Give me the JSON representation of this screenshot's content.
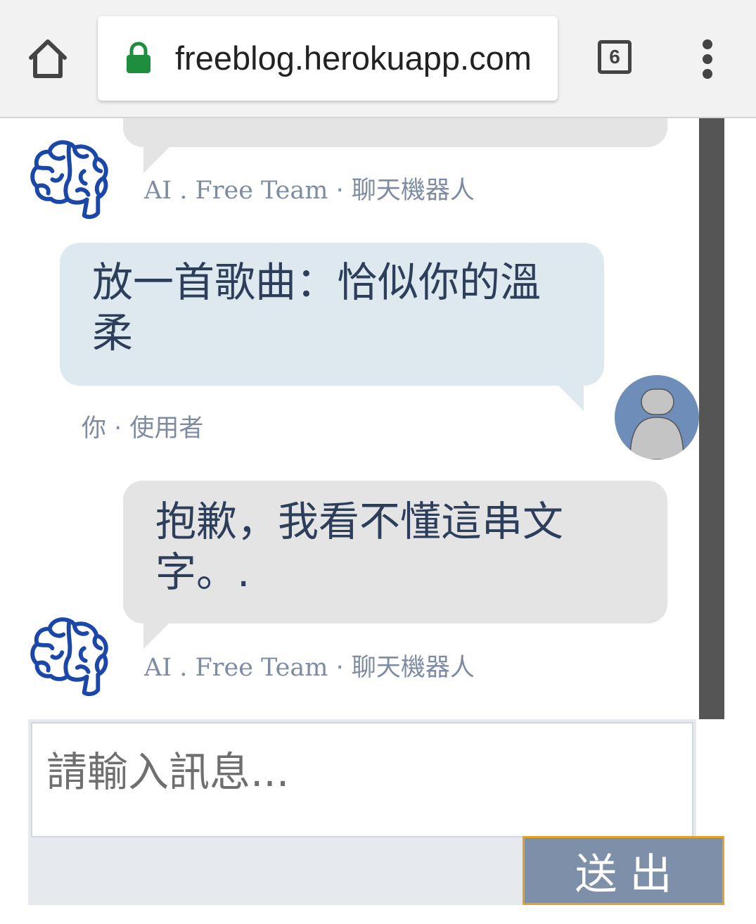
{
  "browser": {
    "url": "freeblog.herokuapp.com",
    "tab_count": "6"
  },
  "chat": {
    "messages": [
      {
        "sender": "bot",
        "text": "",
        "meta_name": "AI . Free Team",
        "meta_role": "· 聊天機器人"
      },
      {
        "sender": "user",
        "text": "放一首歌曲：恰似你的溫柔",
        "meta_name": "你",
        "meta_role": "· 使用者"
      },
      {
        "sender": "bot",
        "text": "抱歉，我看不懂這串文字。.",
        "meta_name": "AI . Free Team",
        "meta_role": "· 聊天機器人"
      }
    ]
  },
  "composer": {
    "placeholder": "請輸入訊息...",
    "value": "",
    "send_label": "送出"
  },
  "colors": {
    "bot_bubble": "#e4e4e4",
    "user_bubble": "#dde9ee",
    "text": "#2c3e5a",
    "meta_text": "#7d8ca3",
    "brain_icon": "#1a47a8",
    "avatar_bg": "#6e8db8",
    "send_button": "#7d8fa9",
    "send_border": "#e0a22a",
    "lock": "#1e8e3e"
  }
}
